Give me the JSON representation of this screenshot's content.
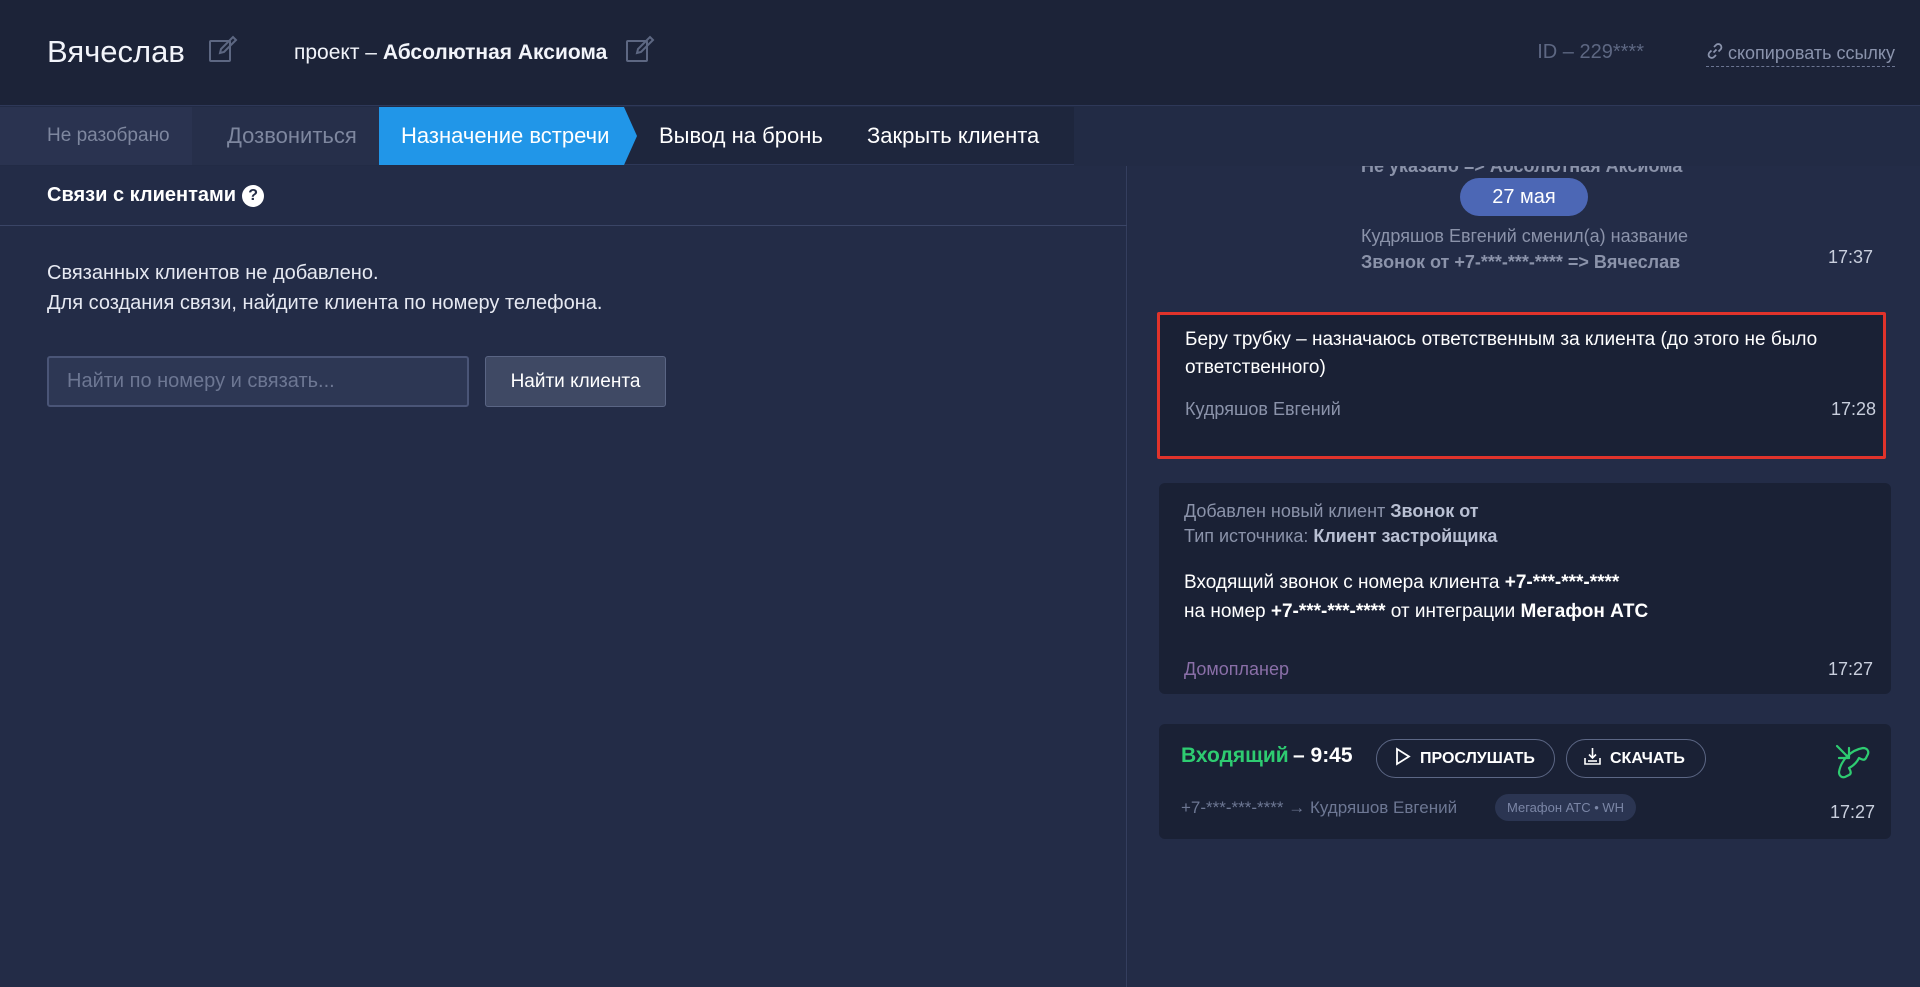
{
  "header": {
    "client_name": "Вячеслав",
    "project_prefix": "проект – ",
    "project_name": "Абсолютная Аксиома",
    "id_text": "ID – 229****",
    "copy_link": "скопировать ссылку"
  },
  "stages": [
    {
      "label": "Не разобрано"
    },
    {
      "label": "Дозвониться"
    },
    {
      "label": "Назначение встречи"
    },
    {
      "label": "Вывод на бронь"
    },
    {
      "label": "Закрыть клиента"
    }
  ],
  "left": {
    "section_title": "Связи с клиентами",
    "empty_line1": "Связанных клиентов не добавлено.",
    "empty_line2": "Для создания связи, найдите клиента по номеру телефона.",
    "search_placeholder": "Найти по номеру и связать...",
    "search_value": "",
    "find_button": "Найти клиента"
  },
  "feed": {
    "cutoff_text": "Не указано => Абсолютная Аксиома",
    "date_pill": "27 мая",
    "rename": {
      "line1": "Кудряшов Евгений сменил(а) название",
      "line2": "Звонок от +7-***-***-**** => Вячеслав",
      "time": "17:37"
    },
    "assign": {
      "text_line1": "Беру трубку – назначаюсь ответственным за клиента (до этого не было",
      "text_line2": "ответственного)",
      "author": "Кудряшов Евгений",
      "time": "17:28"
    },
    "new_client": {
      "added_label": "Добавлен новый клиент ",
      "added_value": "Звонок от",
      "source_label": "Тип источника: ",
      "source_value": "Клиент застройщика",
      "call_line1_a": "Входящий звонок с номера клиента ",
      "call_line1_b": "+7-***-***-****",
      "call_line2_a": "на номер ",
      "call_line2_b": "+7-***-***-****",
      "call_line2_c": " от интеграции ",
      "call_line2_d": "Мегафон АТС",
      "author": "Домопланер",
      "time": "17:27"
    },
    "call": {
      "type": "Входящий",
      "duration": " – 9:45",
      "listen": "ПРОСЛУШАТЬ",
      "download": "СКАЧАТЬ",
      "route": "+7-***-***-**** → Кудряшов Евгений",
      "tag": "Мегафон АТС • WH",
      "time": "17:27"
    }
  },
  "colors": {
    "accent": "#2196e8",
    "incoming": "#2ecc71",
    "highlight_border": "#e0332b",
    "author_domoplaner": "#8a6fa8"
  },
  "icons": [
    "edit-icon",
    "link-icon",
    "help-icon",
    "play-icon",
    "download-icon",
    "incoming-call-icon"
  ]
}
